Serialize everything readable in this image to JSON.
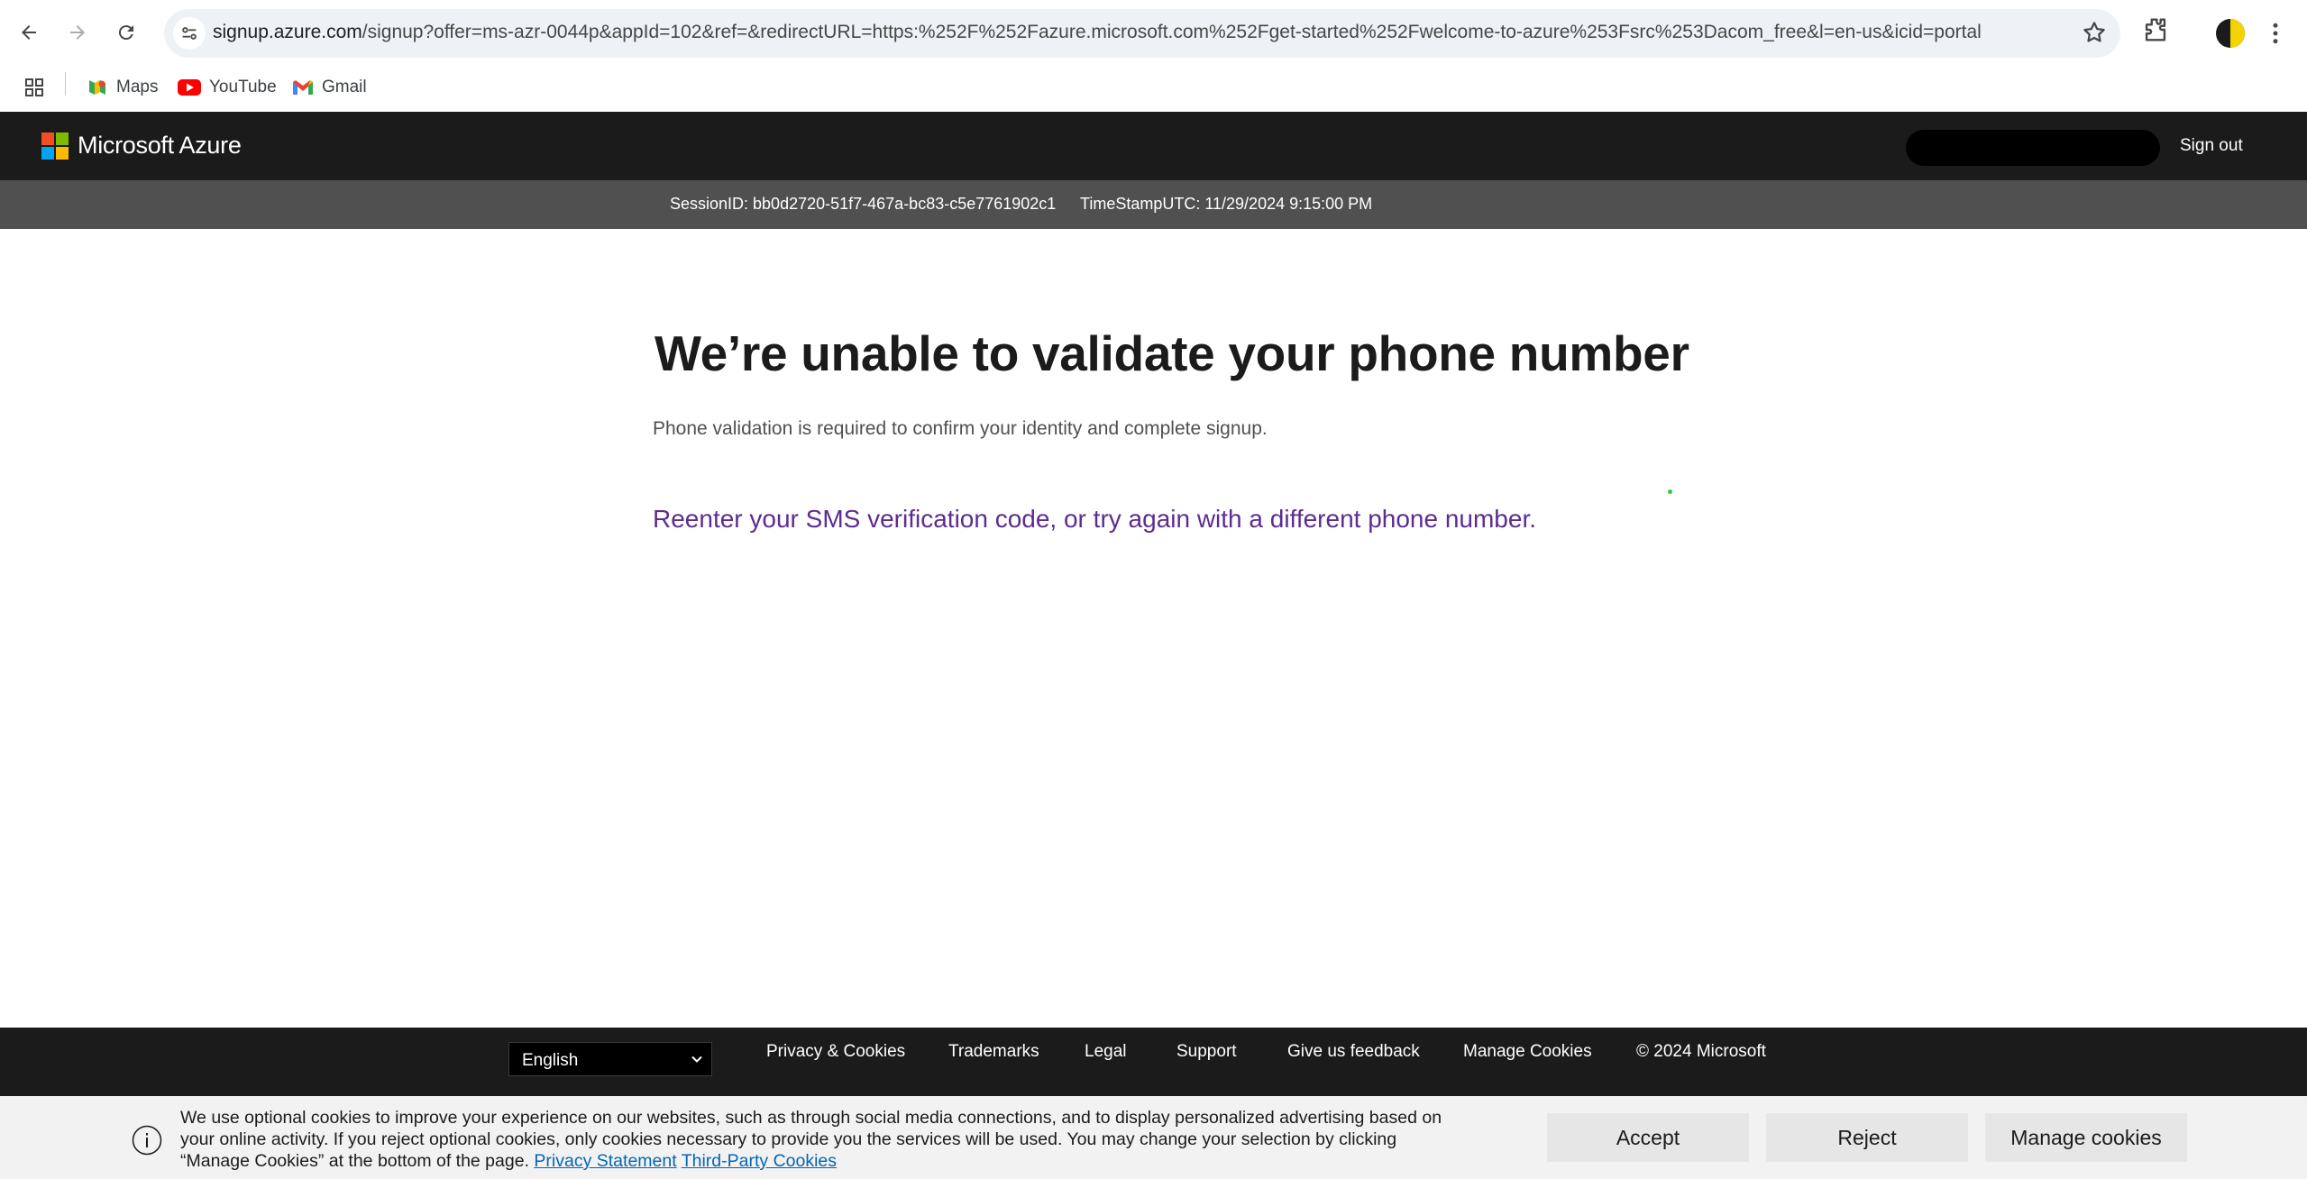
{
  "browser": {
    "url_host": "signup.azure.com",
    "url_path": "/signup?offer=ms-azr-0044p&appId=102&ref=&redirectURL=https:%252F%252Fazure.microsoft.com%252Fget-started%252Fwelcome-to-azure%253Fsrc%253Dacom_free&l=en-us&icid=portal",
    "bookmarks": [
      {
        "label": "Maps",
        "icon": "maps-icon"
      },
      {
        "label": "YouTube",
        "icon": "youtube-icon"
      },
      {
        "label": "Gmail",
        "icon": "gmail-icon"
      }
    ]
  },
  "header": {
    "brand": "Microsoft Azure",
    "sign_out": "Sign out"
  },
  "session": {
    "session_id": "SessionID: bb0d2720-51f7-467a-bc83-c5e7761902c1",
    "timestamp": "TimeStampUTC: 11/29/2024 9:15:00 PM"
  },
  "main": {
    "title": "We’re unable to validate your phone number",
    "subtitle": "Phone validation is required to confirm your identity and complete signup.",
    "retry_link": "Reenter your SMS verification code, or try again with a different phone number."
  },
  "footer": {
    "language": "English",
    "links": [
      "Privacy & Cookies",
      "Trademarks",
      "Legal",
      "Support",
      "Give us feedback",
      "Manage Cookies",
      "© 2024 Microsoft"
    ]
  },
  "cookie_banner": {
    "text": "We use optional cookies to improve your experience on our websites, such as through social media connections, and to display personalized advertising based on your online activity. If you reject optional cookies, only cookies necessary to provide you the services will be used. You may change your selection by clicking “Manage Cookies” at the bottom of the page.",
    "privacy_link": "Privacy Statement",
    "third_party_link": "Third-Party Cookies",
    "accept": "Accept",
    "reject": "Reject",
    "manage": "Manage cookies"
  },
  "colors": {
    "header_bg": "#1b1b1b",
    "session_bg": "#505050",
    "link_purple": "#5c2d91",
    "link_blue": "#0067b8",
    "ms_red": "#f25022",
    "ms_green": "#7fba00",
    "ms_blue": "#00a4ef",
    "ms_yellow": "#ffb900"
  }
}
